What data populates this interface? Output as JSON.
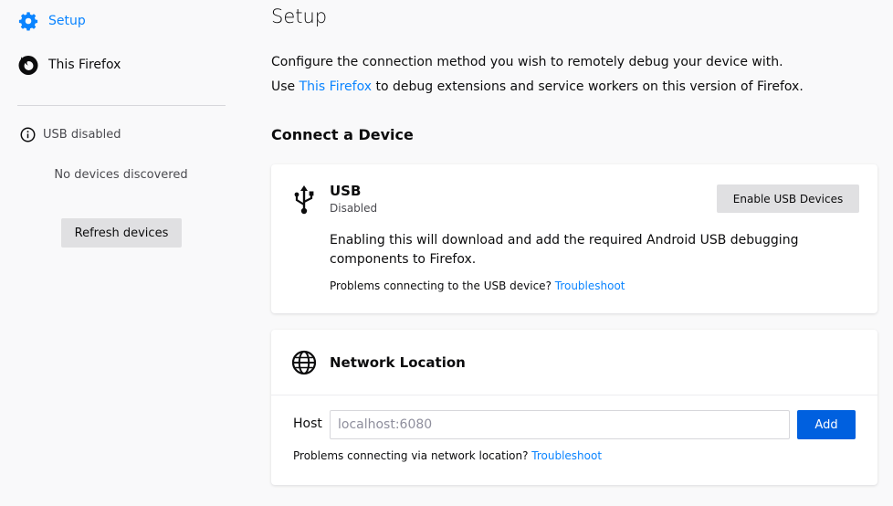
{
  "sidebar": {
    "items": [
      {
        "label": "Setup",
        "icon": "gear-icon",
        "active": true
      },
      {
        "label": "This Firefox",
        "icon": "firefox-icon",
        "active": false
      }
    ],
    "usb_status": "USB disabled",
    "no_devices": "No devices discovered",
    "refresh_label": "Refresh devices"
  },
  "main": {
    "title": "Setup",
    "intro_line1": "Configure the connection method you wish to remotely debug your device with.",
    "intro_line2_prefix": "Use ",
    "intro_line2_link": "This Firefox",
    "intro_line2_suffix": " to debug extensions and service workers on this version of Firefox.",
    "section_title": "Connect a Device",
    "usb": {
      "title": "USB",
      "status": "Disabled",
      "enable_label": "Enable USB Devices",
      "description": "Enabling this will download and add the required Android USB debugging components to Firefox.",
      "problem_text": "Problems connecting to the USB device? ",
      "troubleshoot": "Troubleshoot"
    },
    "network": {
      "title": "Network Location",
      "host_label": "Host",
      "host_placeholder": "localhost:6080",
      "host_value": "",
      "add_label": "Add",
      "problem_text": "Problems connecting via network location? ",
      "troubleshoot": "Troubleshoot"
    }
  },
  "colors": {
    "accent": "#0a84ff",
    "primary_button": "#0060df",
    "secondary_button": "#e0e0e2",
    "background": "#f9f9fa"
  }
}
